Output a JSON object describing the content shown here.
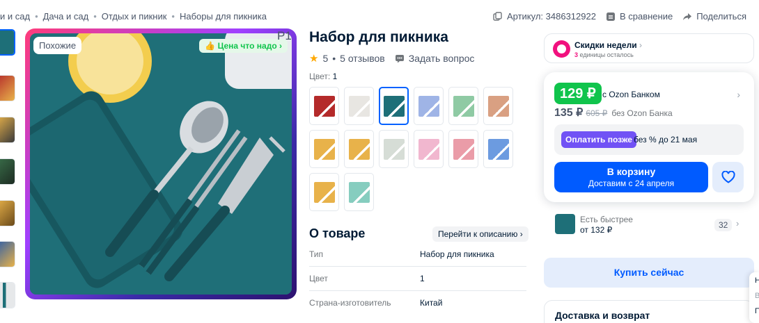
{
  "breadcrumbs": [
    "и и сад",
    "Дача и сад",
    "Отдых и пикник",
    "Наборы для пикника"
  ],
  "meta": {
    "article": "Артикул: 3486312922",
    "compare": "В сравнение",
    "share": "Поделиться"
  },
  "gallery": {
    "similar_label": "Похожие",
    "badge_label": "Цена что надо",
    "corner_text": "P1"
  },
  "product": {
    "title": "Набор для пикника",
    "rating": "5",
    "reviews": "5 отзывов",
    "ask": "Задать вопрос",
    "color_label": "Цвет:",
    "color_value": "1"
  },
  "swatch_colors": [
    "#b42a2a",
    "#e8e6e2",
    "#1e6f78",
    "#9fb4e6",
    "#8fcaa4",
    "#d9a082",
    "#e8b24a",
    "#e8b24a",
    "#d6ddd6",
    "#f1b7cf",
    "#ea9ca8",
    "#6c9be0",
    "#e8b24a",
    "#86cdbf"
  ],
  "thumb_colors": [
    "#1e6f78",
    "#b42a2a",
    "#e8b24a",
    "#3a6f4a",
    "#e8b24a",
    "#2d5da8",
    "#e6e8ea"
  ],
  "about": {
    "heading": "О товаре",
    "link": "Перейти к описанию",
    "specs": [
      {
        "k": "Тип",
        "v": "Набор для пикника"
      },
      {
        "k": "Цвет",
        "v": "1"
      },
      {
        "k": "Страна-изготовитель",
        "v": "Китай"
      }
    ]
  },
  "deals": {
    "title": "Скидки недели",
    "count": "3",
    "remaining": "единицы осталось"
  },
  "pricing": {
    "card_price": "129 ₽",
    "card_note": "с Ozon Банком",
    "price": "135 ₽",
    "old_price": "605 ₽",
    "no_bank_note": "без Ozon Банка",
    "pay_later_button": "Оплатить позже",
    "pay_later_text": "без % до 21 мая",
    "cart_button": "В корзину",
    "cart_delivery": "Доставим с 24 апреля"
  },
  "faster": {
    "line1": "Есть быстрее",
    "line2": "от 132 ₽",
    "count": "32"
  },
  "buy_now": "Купить сейчас",
  "delivery_heading": "Доставка и возврат",
  "edge_letters": [
    "Н",
    "В",
    "П"
  ],
  "colors": {
    "accent": "#005bff",
    "green": "#10c44c",
    "pink": "#f1117e",
    "violet": "#7152f5"
  }
}
